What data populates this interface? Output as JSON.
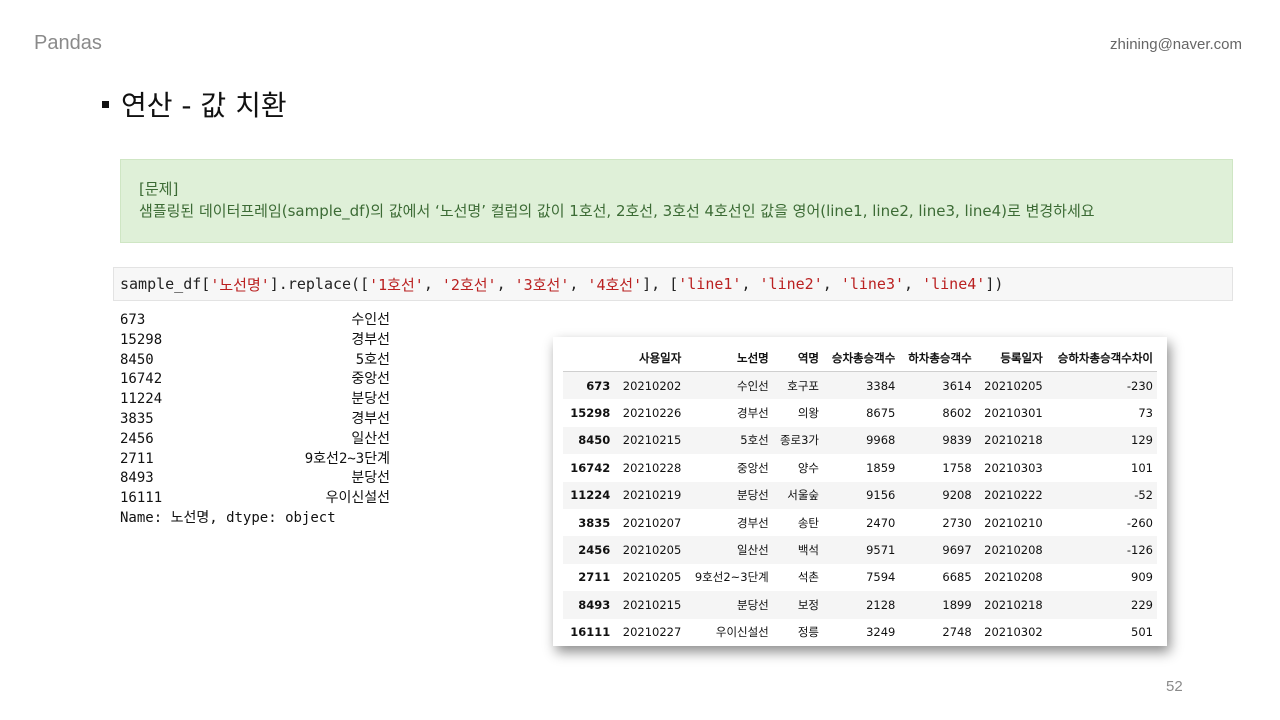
{
  "header": {
    "brand": "Pandas",
    "email": "zhining@naver.com"
  },
  "title": "연산 - 값 치환",
  "problem": {
    "label": "[문제]",
    "text": "샘플링된 데이터프레임(sample_df)의 값에서 ‘노선명’ 컬럼의 값이 1호선, 2호선, 3호선 4호선인 값을 영어(line1, line2, line3, line4)로 변경하세요"
  },
  "code": {
    "p1": "sample_df[",
    "s1": "'노선명'",
    "p2": "].replace([",
    "s2": "'1호선'",
    "c1": ", ",
    "s3": "'2호선'",
    "c2": ", ",
    "s4": "'3호선'",
    "c3": ", ",
    "s5": "'4호선'",
    "p3": "], [",
    "s6": "'line1'",
    "c4": ", ",
    "s7": "'line2'",
    "c5": ", ",
    "s8": "'line3'",
    "c6": ", ",
    "s9": "'line4'",
    "p4": "])"
  },
  "output": {
    "rows": [
      {
        "index": "673",
        "value": "수인선"
      },
      {
        "index": "15298",
        "value": "경부선"
      },
      {
        "index": "8450",
        "value": "5호선"
      },
      {
        "index": "16742",
        "value": "중앙선"
      },
      {
        "index": "11224",
        "value": "분당선"
      },
      {
        "index": "3835",
        "value": "경부선"
      },
      {
        "index": "2456",
        "value": "일산선"
      },
      {
        "index": "2711",
        "value": "9호선2~3단계"
      },
      {
        "index": "8493",
        "value": "분당선"
      },
      {
        "index": "16111",
        "value": "우이신설선"
      }
    ],
    "footer": "Name: 노선명, dtype: object"
  },
  "table": {
    "columns": [
      "",
      "사용일자",
      "노선명",
      "역명",
      "승차총승객수",
      "하차총승객수",
      "등록일자",
      "승하차총승객수차이"
    ],
    "rows": [
      [
        "673",
        "20210202",
        "수인선",
        "호구포",
        "3384",
        "3614",
        "20210205",
        "-230"
      ],
      [
        "15298",
        "20210226",
        "경부선",
        "의왕",
        "8675",
        "8602",
        "20210301",
        "73"
      ],
      [
        "8450",
        "20210215",
        "5호선",
        "종로3가",
        "9968",
        "9839",
        "20210218",
        "129"
      ],
      [
        "16742",
        "20210228",
        "중앙선",
        "양수",
        "1859",
        "1758",
        "20210303",
        "101"
      ],
      [
        "11224",
        "20210219",
        "분당선",
        "서울숲",
        "9156",
        "9208",
        "20210222",
        "-52"
      ],
      [
        "3835",
        "20210207",
        "경부선",
        "송탄",
        "2470",
        "2730",
        "20210210",
        "-260"
      ],
      [
        "2456",
        "20210205",
        "일산선",
        "백석",
        "9571",
        "9697",
        "20210208",
        "-126"
      ],
      [
        "2711",
        "20210205",
        "9호선2~3단계",
        "석촌",
        "7594",
        "6685",
        "20210208",
        "909"
      ],
      [
        "8493",
        "20210215",
        "분당선",
        "보정",
        "2128",
        "1899",
        "20210218",
        "229"
      ],
      [
        "16111",
        "20210227",
        "우이신설선",
        "정릉",
        "3249",
        "2748",
        "20210302",
        "501"
      ]
    ]
  },
  "page": {
    "number": "52"
  }
}
